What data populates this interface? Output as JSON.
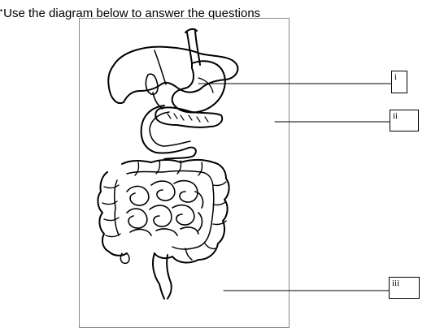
{
  "instruction": {
    "mark": "•",
    "text": "Use the diagram below to answer the questions"
  },
  "labels": [
    {
      "id": "i",
      "text": "i"
    },
    {
      "id": "ii",
      "text": "ii"
    },
    {
      "id": "iii",
      "text": "iii"
    }
  ]
}
